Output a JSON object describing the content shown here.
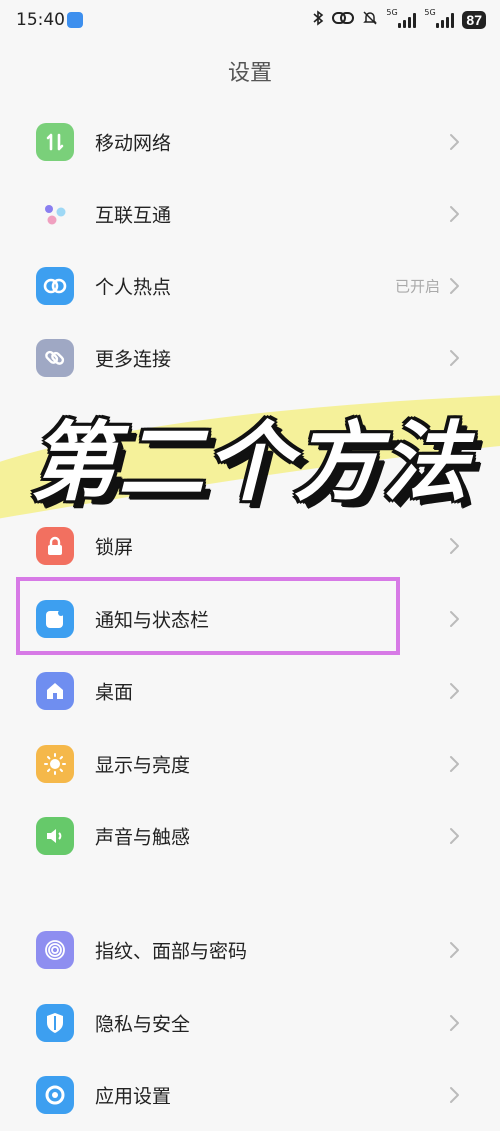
{
  "status": {
    "time": "15:40",
    "sig1_tag": "5G",
    "sig2_tag": "5G",
    "battery": "87"
  },
  "header": {
    "title": "设置"
  },
  "rows": [
    {
      "label": "移动网络",
      "value": "",
      "color": "#7ad07a",
      "icon": "mobile-network-icon"
    },
    {
      "label": "互联互通",
      "value": "",
      "color": "",
      "icon": "interconnect-icon"
    },
    {
      "label": "个人热点",
      "value": "已开启",
      "color": "#3d9ff0",
      "icon": "hotspot-icon"
    },
    {
      "label": "更多连接",
      "value": "",
      "color": "#9fa8c4",
      "icon": "link-icon"
    },
    {
      "label": "锁屏",
      "value": "",
      "color": "#f27060",
      "icon": "lock-icon"
    },
    {
      "label": "通知与状态栏",
      "value": "",
      "color": "#3d9ff0",
      "icon": "notification-icon"
    },
    {
      "label": "桌面",
      "value": "",
      "color": "#6f8ef0",
      "icon": "home-icon"
    },
    {
      "label": "显示与亮度",
      "value": "",
      "color": "#f5b84a",
      "icon": "sun-icon"
    },
    {
      "label": "声音与触感",
      "value": "",
      "color": "#66c96a",
      "icon": "speaker-icon"
    },
    {
      "label": "指纹、面部与密码",
      "value": "",
      "color": "#8e8ef0",
      "icon": "fingerprint-icon"
    },
    {
      "label": "隐私与安全",
      "value": "",
      "color": "#3d9ff0",
      "icon": "shield-icon"
    },
    {
      "label": "应用设置",
      "value": "",
      "color": "#3d9ff0",
      "icon": "app-settings-icon"
    }
  ],
  "overlay": {
    "text": "第二个方法",
    "banner_color": "#f4f08a",
    "highlight_color": "#d77ae6"
  }
}
